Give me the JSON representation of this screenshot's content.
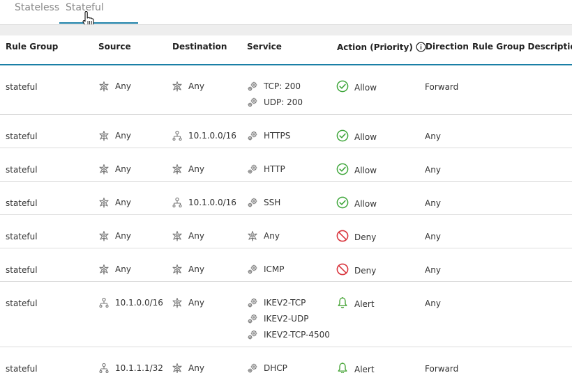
{
  "tabs": [
    {
      "label": "Stateless",
      "selected": false
    },
    {
      "label": "Stateful",
      "selected": true
    }
  ],
  "columns": {
    "rule_group": "Rule Group",
    "source": "Source",
    "destination": "Destination",
    "service": "Service",
    "action": "Action (Priority)",
    "direction": "Direction",
    "description": "Rule Group Description"
  },
  "colors": {
    "accent": "#1a7fa6",
    "allow": "#3ea63a",
    "deny": "#d9363e",
    "alert": "#4aa63a"
  },
  "rows": [
    {
      "rule_group": "stateful",
      "source": "Any",
      "source_icon": "any-icon",
      "destination": "Any",
      "destination_icon": "any-icon",
      "services": [
        {
          "icon": "gear-icon",
          "label": "TCP: 200"
        },
        {
          "icon": "gear-icon",
          "label": "UDP: 200"
        }
      ],
      "action": "Allow",
      "action_icon": "check-circle-icon",
      "direction": "Forward",
      "description": ""
    },
    {
      "rule_group": "stateful",
      "source": "Any",
      "source_icon": "any-icon",
      "destination": "10.1.0.0/16",
      "destination_icon": "network-icon",
      "services": [
        {
          "icon": "gear-icon",
          "label": "HTTPS"
        }
      ],
      "action": "Allow",
      "action_icon": "check-circle-icon",
      "direction": "Any",
      "description": ""
    },
    {
      "rule_group": "stateful",
      "source": "Any",
      "source_icon": "any-icon",
      "destination": "Any",
      "destination_icon": "any-icon",
      "services": [
        {
          "icon": "gear-icon",
          "label": "HTTP"
        }
      ],
      "action": "Allow",
      "action_icon": "check-circle-icon",
      "direction": "Any",
      "description": ""
    },
    {
      "rule_group": "stateful",
      "source": "Any",
      "source_icon": "any-icon",
      "destination": "10.1.0.0/16",
      "destination_icon": "network-icon",
      "services": [
        {
          "icon": "gear-icon",
          "label": "SSH"
        }
      ],
      "action": "Allow",
      "action_icon": "check-circle-icon",
      "direction": "Any",
      "description": ""
    },
    {
      "rule_group": "stateful",
      "source": "Any",
      "source_icon": "any-icon",
      "destination": "Any",
      "destination_icon": "any-icon",
      "services": [
        {
          "icon": "any-icon",
          "label": "Any"
        }
      ],
      "action": "Deny",
      "action_icon": "no-entry-icon",
      "direction": "Any",
      "description": ""
    },
    {
      "rule_group": "stateful",
      "source": "Any",
      "source_icon": "any-icon",
      "destination": "Any",
      "destination_icon": "any-icon",
      "services": [
        {
          "icon": "gear-icon",
          "label": "ICMP"
        }
      ],
      "action": "Deny",
      "action_icon": "no-entry-icon",
      "direction": "Any",
      "description": ""
    },
    {
      "rule_group": "stateful",
      "source": "10.1.0.0/16",
      "source_icon": "network-icon",
      "destination": "Any",
      "destination_icon": "any-icon",
      "services": [
        {
          "icon": "gear-icon",
          "label": "IKEV2-TCP"
        },
        {
          "icon": "gear-icon",
          "label": "IKEV2-UDP"
        },
        {
          "icon": "gear-icon",
          "label": "IKEV2-TCP-4500"
        }
      ],
      "action": "Alert",
      "action_icon": "bell-icon",
      "direction": "Any",
      "description": ""
    },
    {
      "rule_group": "stateful",
      "source": "10.1.1.1/32",
      "source_icon": "network-icon",
      "destination": "Any",
      "destination_icon": "any-icon",
      "services": [
        {
          "icon": "gear-icon",
          "label": "DHCP"
        }
      ],
      "action": "Alert",
      "action_icon": "bell-icon",
      "direction": "Forward",
      "description": ""
    }
  ]
}
